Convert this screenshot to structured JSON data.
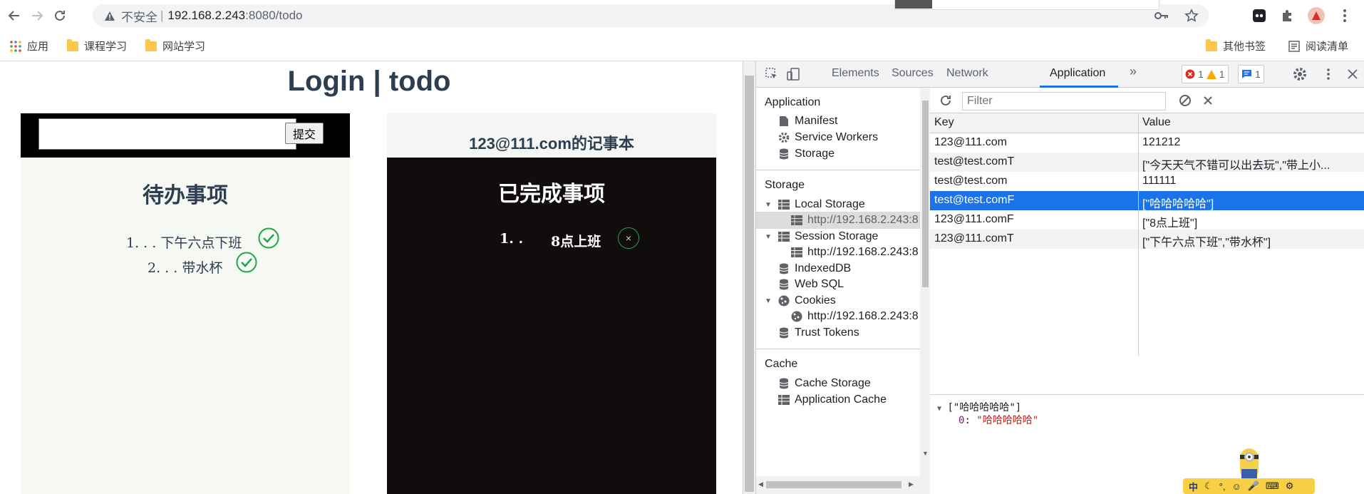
{
  "browser": {
    "insecure_label": "不安全",
    "url_host": "192.168.2.243",
    "url_path": ":8080/todo"
  },
  "bookmarks": {
    "apps": "应用",
    "items": [
      "课程学习",
      "网站学习"
    ],
    "other": "其他书签",
    "reading_list": "阅读清单"
  },
  "page": {
    "title": "Login | todo",
    "input_value": "",
    "submit_label": "提交",
    "todo_title": "待办事项",
    "todos": [
      {
        "num": "1. . .",
        "text": "下午六点下班"
      },
      {
        "num": "2. . .",
        "text": "带水杯"
      }
    ],
    "notebook_title": "123@111.com的记事本",
    "done_title": "已完成事项",
    "done": [
      {
        "num": "1. .",
        "text": "8点上班",
        "delete": "×"
      }
    ]
  },
  "devtools": {
    "tabs": [
      "Elements",
      "Sources",
      "Network",
      "Application"
    ],
    "active_tab": "Application",
    "more": "»",
    "errors": "1",
    "warnings": "1",
    "messages": "1",
    "sidebar": {
      "application_header": "Application",
      "application_items": [
        "Manifest",
        "Service Workers",
        "Storage"
      ],
      "storage_header": "Storage",
      "local_storage": "Local Storage",
      "local_origin": "http://192.168.2.243:8",
      "session_storage": "Session Storage",
      "session_origin": "http://192.168.2.243:8",
      "indexeddb": "IndexedDB",
      "websql": "Web SQL",
      "cookies": "Cookies",
      "cookies_origin": "http://192.168.2.243:8",
      "trust_tokens": "Trust Tokens",
      "cache_header": "Cache",
      "cache_storage": "Cache Storage",
      "app_cache": "Application Cache"
    },
    "filter_placeholder": "Filter",
    "table": {
      "key_header": "Key",
      "value_header": "Value",
      "rows": [
        {
          "key": "123@111.com",
          "value": "121212"
        },
        {
          "key": "test@test.comT",
          "value": "[\"今天天气不错可以出去玩\",\"带上小..."
        },
        {
          "key": "test@test.com",
          "value": "111111"
        },
        {
          "key": "test@test.comF",
          "value": "[\"哈哈哈哈哈\"]"
        },
        {
          "key": "123@111.comF",
          "value": "[\"8点上班\"]"
        },
        {
          "key": "123@111.comT",
          "value": "[\"下午六点下班\",\"带水杯\"]"
        }
      ],
      "selected_index": 3
    },
    "preview": {
      "root": "[\"哈哈哈哈哈\"]",
      "index": "0",
      "value": "\"哈哈哈哈哈\""
    }
  },
  "ime": {
    "label": "中"
  },
  "colors": {
    "accent": "#1a73e8",
    "title": "#2c3e50",
    "check": "#1fa64a",
    "dark_panel": "#120d0d"
  }
}
